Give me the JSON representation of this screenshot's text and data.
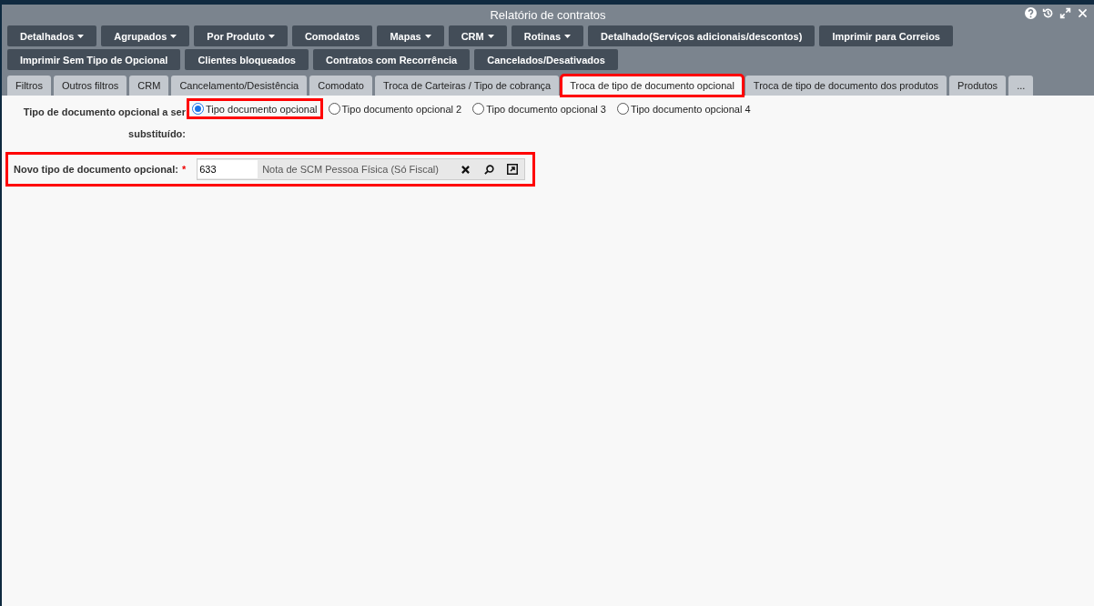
{
  "window": {
    "title": "Relatório de contratos"
  },
  "toolbar_rows": [
    [
      {
        "label": "Detalhados",
        "dropdown": true
      },
      {
        "label": "Agrupados",
        "dropdown": true
      },
      {
        "label": "Por Produto",
        "dropdown": true
      },
      {
        "label": "Comodatos",
        "dropdown": false
      },
      {
        "label": "Mapas",
        "dropdown": true
      },
      {
        "label": "CRM",
        "dropdown": true
      },
      {
        "label": "Rotinas",
        "dropdown": true
      },
      {
        "label": "Detalhado(Serviços adicionais/descontos)",
        "dropdown": false
      },
      {
        "label": "Imprimir para Correios",
        "dropdown": false
      }
    ],
    [
      {
        "label": "Imprimir Sem Tipo de Opcional",
        "dropdown": false
      },
      {
        "label": "Clientes bloqueados",
        "dropdown": false
      },
      {
        "label": "Contratos com Recorrência",
        "dropdown": false
      },
      {
        "label": "Cancelados/Desativados",
        "dropdown": false
      }
    ]
  ],
  "tabs": [
    {
      "label": "Filtros",
      "selected": false
    },
    {
      "label": "Outros filtros",
      "selected": false
    },
    {
      "label": "CRM",
      "selected": false
    },
    {
      "label": "Cancelamento/Desistência",
      "selected": false
    },
    {
      "label": "Comodato",
      "selected": false
    },
    {
      "label": "Troca de Carteiras / Tipo de cobrança",
      "selected": false
    },
    {
      "label": "Troca de tipo de documento opcional",
      "selected": true
    },
    {
      "label": "Troca de tipo de documento dos produtos",
      "selected": false
    },
    {
      "label": "Produtos",
      "selected": false
    },
    {
      "label": "...",
      "selected": false
    }
  ],
  "radio_group": {
    "label": "Tipo de documento opcional a ser substituído:",
    "options": [
      {
        "label": "Tipo documento opcional",
        "selected": true
      },
      {
        "label": "Tipo documento opcional 2",
        "selected": false
      },
      {
        "label": "Tipo documento opcional 3",
        "selected": false
      },
      {
        "label": "Tipo documento opcional 4",
        "selected": false
      }
    ]
  },
  "lookup_field": {
    "label": "Novo tipo de documento opcional:",
    "required_mark": "*",
    "value": "633",
    "description": "Nota de SCM Pessoa Física  (Só Fiscal)"
  }
}
